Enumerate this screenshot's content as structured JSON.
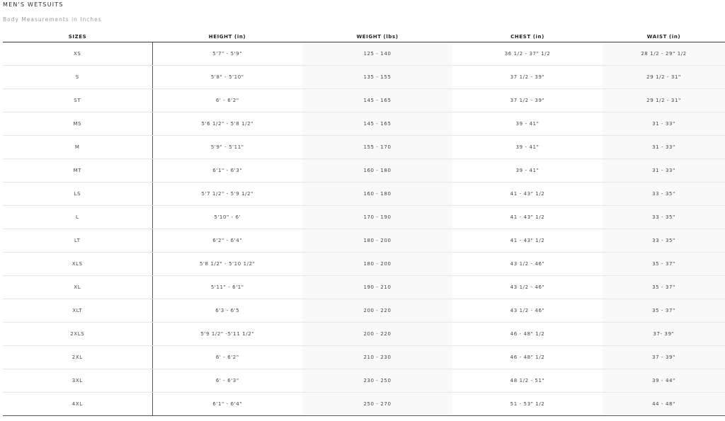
{
  "title": "MEN'S WETSUITS",
  "subtitle": "Body Measurements in Inches",
  "table": {
    "headers": [
      "SIZES",
      "HEIGHT (in)",
      "WEIGHT (lbs)",
      "CHEST (in)",
      "WAIST (in)"
    ],
    "rows": [
      [
        "XS",
        "5'7\" - 5'9\"",
        "125 - 140",
        "36 1/2 - 37\" 1/2",
        "28 1/2 - 29\" 1/2"
      ],
      [
        "S",
        "5'8\" - 5'10\"",
        "135 - 155",
        "37 1/2 - 39\"",
        "29 1/2 - 31\""
      ],
      [
        "ST",
        "6' - 6'2\"",
        "145 - 165",
        "37 1/2 - 39\"",
        "29 1/2 - 31\""
      ],
      [
        "MS",
        "5'6 1/2\" - 5'8 1/2\"",
        "145 - 165",
        "39 - 41\"",
        "31 - 33\""
      ],
      [
        "M",
        "5'9\" - 5'11\"",
        "155 - 170",
        "39 - 41\"",
        "31 - 33\""
      ],
      [
        "MT",
        "6'1\" - 6'3\"",
        "160 - 180",
        "39 - 41\"",
        "31 - 33\""
      ],
      [
        "LS",
        "5'7 1/2\" - 5'9 1/2\"",
        "160 - 180",
        "41 - 43\" 1/2",
        "33 - 35\""
      ],
      [
        "L",
        "5'10\" - 6'",
        "170 - 190",
        "41 - 43\" 1/2",
        "33 - 35\""
      ],
      [
        "LT",
        "6'2\" - 6'4\"",
        "180 - 200",
        "41 - 43\" 1/2",
        "33 - 35\""
      ],
      [
        "XLS",
        "5'8 1/2\" - 5'10 1/2\"",
        "180 - 200",
        "43 1/2 - 46\"",
        "35 - 37\""
      ],
      [
        "XL",
        "5'11\" - 6'1\"",
        "190 - 210",
        "43 1/2 - 46\"",
        "35 - 37\""
      ],
      [
        "XLT",
        "6'3 - 6'5",
        "200 - 220",
        "43 1/2 - 46\"",
        "35 - 37\""
      ],
      [
        "2XLS",
        "5'9 1/2\" -5'11 1/2\"",
        "200 - 220",
        "46 - 48\" 1/2",
        "37- 39\""
      ],
      [
        "2XL",
        "6' - 6'2\"",
        "210 - 230",
        "46 - 48\" 1/2",
        "37 - 39\""
      ],
      [
        "3XL",
        "6' - 6'3\"",
        "230 - 250",
        "48 1/2 - 51\"",
        "39 - 44\""
      ],
      [
        "4XL",
        "6'1\" - 6'4\"",
        "250 - 270",
        "51 - 53\" 1/2",
        "44 - 48\""
      ]
    ]
  },
  "colors": {
    "shade": "#f9f9f9",
    "rule": "#e6e6e6",
    "border": "#555555"
  }
}
